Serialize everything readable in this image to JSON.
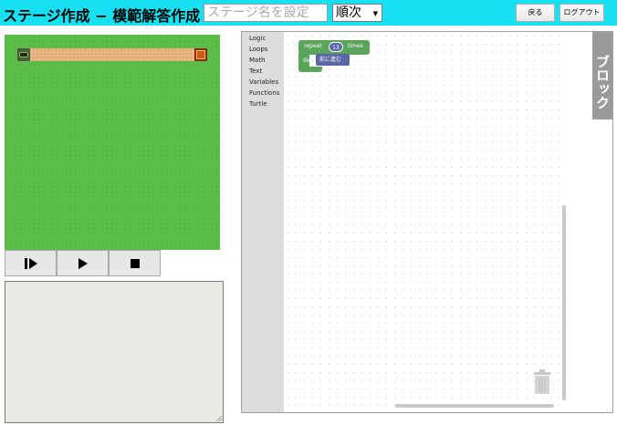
{
  "header": {
    "title": "ステージ作成 − 模範解答作成",
    "stage_name_placeholder": "ステージ名を設定",
    "mode_select": "順次",
    "back_button": "戻る",
    "logout_button": "ログアウト"
  },
  "stage": {
    "icons": [
      "robot-icon",
      "treasure-chest-icon"
    ]
  },
  "controls": {
    "icons": [
      "step-icon",
      "play-icon",
      "stop-icon"
    ]
  },
  "toolbox": {
    "categories": [
      "Logic",
      "Loops",
      "Math",
      "Text",
      "Variables",
      "Functions",
      "Turtle"
    ]
  },
  "blocks": {
    "repeat_label": "repeat",
    "repeat_count": "13",
    "times_label": "times",
    "do_label": "do",
    "move_label": "前に進む"
  },
  "block_tab": "ブロック",
  "colors": {
    "header": "#16e0f2",
    "stage_grass": "#5cbd49",
    "path": "#e7b683",
    "loop_block": "#5ba55b",
    "action_block": "#5b67a5",
    "block_tab": "#9a9a9a"
  }
}
